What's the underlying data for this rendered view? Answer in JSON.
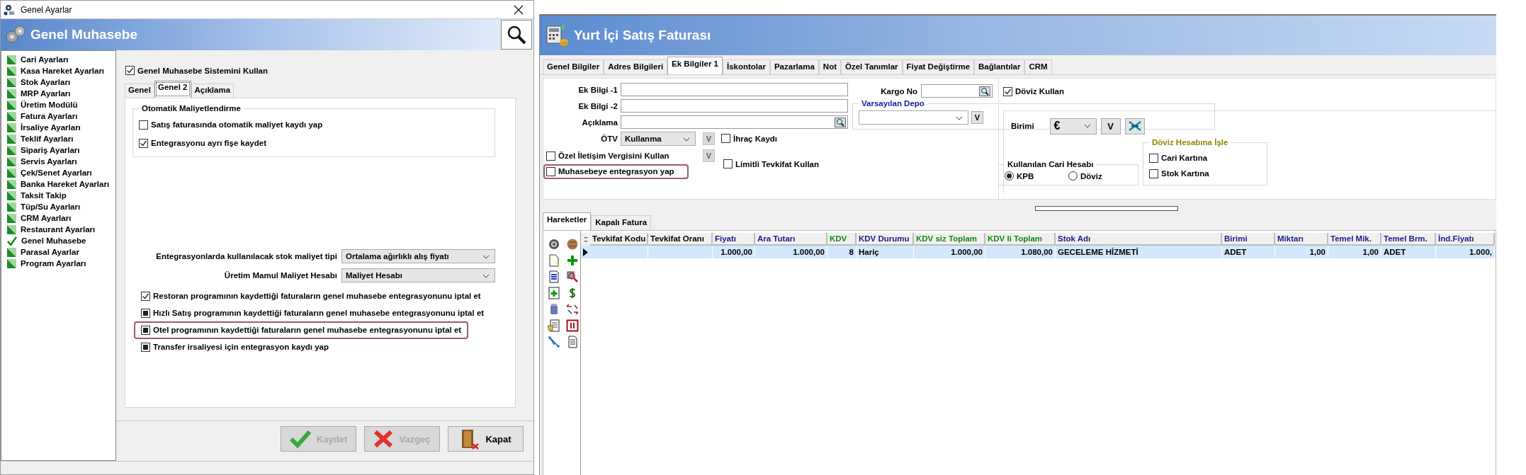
{
  "settings_window": {
    "title": "Genel Ayarlar",
    "header": "Genel Muhasebe",
    "sidebar": {
      "items": [
        {
          "label": "Cari Ayarları",
          "selected": false
        },
        {
          "label": "Kasa Hareket Ayarları",
          "selected": false
        },
        {
          "label": "Stok Ayarları",
          "selected": false
        },
        {
          "label": "MRP Ayarları",
          "selected": false
        },
        {
          "label": "Üretim Modülü",
          "selected": false
        },
        {
          "label": "Fatura Ayarları",
          "selected": false
        },
        {
          "label": "İrsaliye Ayarları",
          "selected": false
        },
        {
          "label": "Teklif Ayarları",
          "selected": false
        },
        {
          "label": "Sipariş Ayarları",
          "selected": false
        },
        {
          "label": "Servis Ayarları",
          "selected": false
        },
        {
          "label": "Çek/Senet Ayarları",
          "selected": false
        },
        {
          "label": "Banka Hareket Ayarları",
          "selected": false
        },
        {
          "label": "Taksit Takip",
          "selected": false
        },
        {
          "label": "Tüp/Su Ayarları",
          "selected": false
        },
        {
          "label": "CRM Ayarları",
          "selected": false
        },
        {
          "label": "Restaurant Ayarları",
          "selected": false
        },
        {
          "label": "Genel Muhasebe",
          "selected": true
        },
        {
          "label": "Parasal Ayarlar",
          "selected": false
        },
        {
          "label": "Program Ayarları",
          "selected": false
        }
      ]
    },
    "use_system": {
      "label": "Genel Muhasebe Sistemini Kullan",
      "checked": true
    },
    "tabs": [
      {
        "label": "Genel",
        "selected": false
      },
      {
        "label": "Genel 2",
        "selected": true
      },
      {
        "label": "Açıklama",
        "selected": false
      }
    ],
    "group": {
      "title": "Otomatik Maliyetlendirme",
      "options": [
        {
          "label": "Satış faturasında otomatik maliyet kaydı yap",
          "checked": false
        },
        {
          "label": "Entegrasyonu ayrı fişe kaydet",
          "checked": true
        }
      ]
    },
    "selects": [
      {
        "label": "Entegrasyonlarda kullanılacak stok maliyet tipi",
        "value": "Ortalama ağırlıklı alış fiyatı"
      },
      {
        "label": "Üretim Mamul Maliyet Hesabı",
        "value": "Maliyet Hesabı"
      }
    ],
    "options": [
      {
        "label": "Restoran programının kaydettiği faturaların genel muhasebe entegrasyonunu iptal et",
        "checked": true,
        "indeterminate": false,
        "highlighted": false
      },
      {
        "label": "Hızlı Satış programının kaydettiği faturaların genel muhasebe entegrasyonunu iptal et",
        "checked": false,
        "indeterminate": true,
        "highlighted": false
      },
      {
        "label": "Otel programının kaydettiği faturaların genel muhasebe entegrasyonunu iptal et",
        "checked": false,
        "indeterminate": true,
        "highlighted": true
      },
      {
        "label": "Transfer irsaliyesi için entegrasyon kaydı yap",
        "checked": false,
        "indeterminate": true,
        "highlighted": false
      }
    ],
    "buttons": [
      {
        "label": "Kaydet",
        "kind": "save",
        "disabled": true
      },
      {
        "label": "Vazgeç",
        "kind": "cancel",
        "disabled": true
      },
      {
        "label": "Kapat",
        "kind": "close",
        "disabled": false
      }
    ]
  },
  "invoice_window": {
    "title": "Yurt İçi Satış Faturası",
    "tabs": [
      {
        "label": "Genel Bilgiler",
        "selected": false
      },
      {
        "label": "Adres Bilgileri",
        "selected": false
      },
      {
        "label": "Ek Bilgiler 1",
        "selected": true
      },
      {
        "label": "İskontolar",
        "selected": false
      },
      {
        "label": "Pazarlama",
        "selected": false
      },
      {
        "label": "Not",
        "selected": false
      },
      {
        "label": "Özel Tanımlar",
        "selected": false
      },
      {
        "label": "Fiyat Değiştirme",
        "selected": false
      },
      {
        "label": "Bağlantılar",
        "selected": false
      },
      {
        "label": "CRM",
        "selected": false
      }
    ],
    "fields": [
      {
        "label": "Ek Bilgi -1",
        "lookup": false
      },
      {
        "label": "Ek Bilgi -2",
        "lookup": false
      },
      {
        "label": "Açıklama",
        "lookup": true
      }
    ],
    "otv": {
      "label": "ÖTV",
      "value": "Kullanma",
      "button": "V"
    },
    "left_checks": [
      {
        "label": "Özel İletişim Vergisini Kullan",
        "checked": false,
        "highlighted": false,
        "button": "V"
      },
      {
        "label": "Muhasebeye entegrasyon yap",
        "checked": false,
        "highlighted": true
      }
    ],
    "checks": [
      {
        "label": "İhraç Kaydı",
        "checked": false
      },
      {
        "label": "Limitli Tevkifat Kullan",
        "checked": false
      }
    ],
    "cargo": {
      "label": "Kargo No"
    },
    "depot": {
      "title": "Varsayılan Depo",
      "button": "V"
    },
    "currency": {
      "label": "Döviz Kullan",
      "checked": true,
      "unit_label": "Birimi",
      "unit_value": "€",
      "button": "V"
    },
    "account": {
      "title": "Kullanılan Cari Hesabı",
      "options": [
        {
          "label": "KPB",
          "selected": true
        },
        {
          "label": "Döviz",
          "selected": false
        }
      ]
    },
    "post": {
      "title": "Döviz Hesabına İşle",
      "options": [
        {
          "label": "Cari Kartına",
          "checked": false
        },
        {
          "label": "Stok Kartına",
          "checked": false
        }
      ]
    },
    "bottom_tabs": [
      {
        "label": "Hareketler",
        "selected": true
      },
      {
        "label": "Kapalı Fatura",
        "selected": false
      }
    ],
    "table": {
      "columns": [
        {
          "label": "Tevkifat Kodu",
          "color": "#000000",
          "kind": "text"
        },
        {
          "label": "Tevkifat Oranı",
          "color": "#000000",
          "kind": "text"
        },
        {
          "label": "Fiyatı",
          "color": "#1a1a8c",
          "kind": "number"
        },
        {
          "label": "Ara Tutarı",
          "color": "#1a1a8c",
          "kind": "number"
        },
        {
          "label": "KDV",
          "color": "#108a10",
          "kind": "number"
        },
        {
          "label": "KDV Durumu",
          "color": "#1a1a8c",
          "kind": "text"
        },
        {
          "label": "KDV siz Toplam",
          "color": "#108a10",
          "kind": "number"
        },
        {
          "label": "KDV li Toplam",
          "color": "#108a10",
          "kind": "number"
        },
        {
          "label": "Stok Adı",
          "color": "#1a1a8c",
          "kind": "text"
        },
        {
          "label": "Birimi",
          "color": "#1a1a8c",
          "kind": "text"
        },
        {
          "label": "Miktarı",
          "color": "#1a1a8c",
          "kind": "number"
        },
        {
          "label": "Temel Mik.",
          "color": "#1a1a8c",
          "kind": "number"
        },
        {
          "label": "Temel Brm.",
          "color": "#1a1a8c",
          "kind": "text"
        },
        {
          "label": "İnd.Fiyatı",
          "color": "#1a1a8c",
          "kind": "number"
        }
      ],
      "rows": [
        {
          "selected": true,
          "cells": [
            null,
            null,
            "1.000,00",
            "1.000,00",
            "8",
            "Hariç",
            "1.000,00",
            "1.080,00",
            "GECELEME HİZMETİ",
            "ADET",
            "1,00",
            "1,00",
            "ADET",
            "1.000,"
          ]
        }
      ]
    }
  }
}
